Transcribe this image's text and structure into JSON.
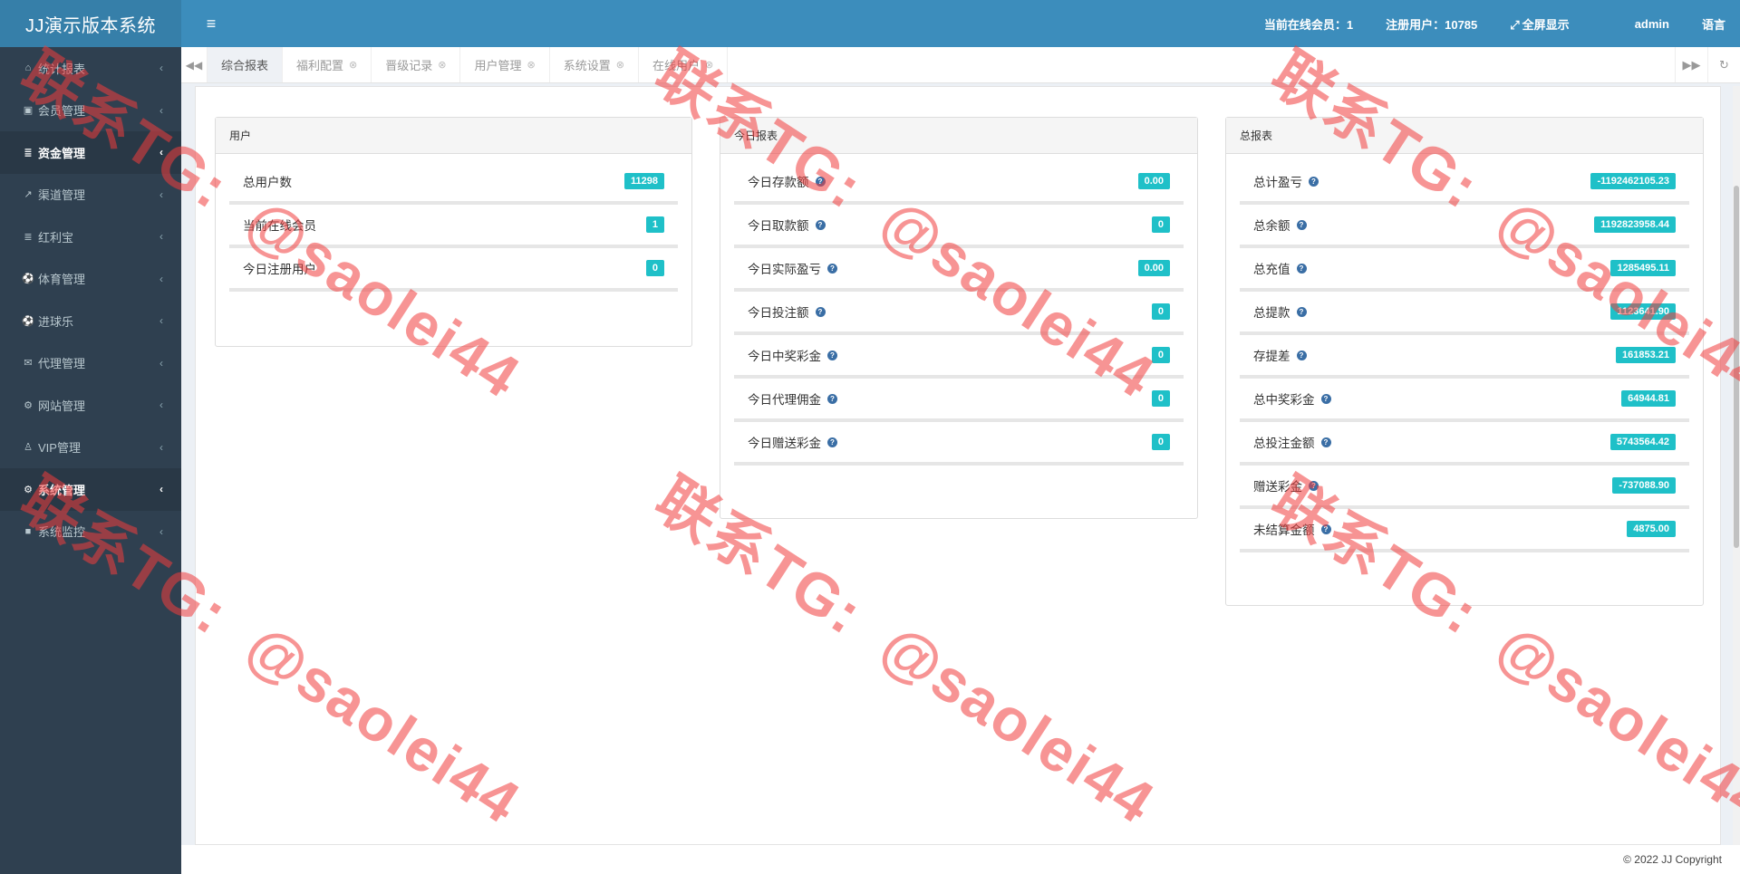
{
  "app": {
    "title": "JJ演示版本系统"
  },
  "sidebar": {
    "items": [
      {
        "label": "统计报表",
        "icon": "home-icon",
        "glyph": "⌂",
        "active": false
      },
      {
        "label": "会员管理",
        "icon": "id-card-icon",
        "glyph": "▣",
        "active": false
      },
      {
        "label": "资金管理",
        "icon": "database-icon",
        "glyph": "≣",
        "active": true
      },
      {
        "label": "渠道管理",
        "icon": "rocket-icon",
        "glyph": "↗",
        "active": false
      },
      {
        "label": "红利宝",
        "icon": "database-icon",
        "glyph": "≣",
        "active": false
      },
      {
        "label": "体育管理",
        "icon": "soccer-ball-icon",
        "glyph": "⚽",
        "active": false
      },
      {
        "label": "进球乐",
        "icon": "soccer-ball-icon",
        "glyph": "⚽",
        "active": false
      },
      {
        "label": "代理管理",
        "icon": "envelope-icon",
        "glyph": "✉",
        "active": false
      },
      {
        "label": "网站管理",
        "icon": "cogs-icon",
        "glyph": "⚙",
        "active": false
      },
      {
        "label": "VIP管理",
        "icon": "user-icon",
        "glyph": "♙",
        "active": false
      },
      {
        "label": "系统管理",
        "icon": "gear-icon",
        "glyph": "⚙",
        "active": true
      },
      {
        "label": "系统监控",
        "icon": "video-camera-icon",
        "glyph": "■",
        "active": false
      }
    ]
  },
  "topbar": {
    "online_members": "当前在线会员：1",
    "registered_users": "注册用户：10785",
    "fullscreen": "全屏显示",
    "user": "admin",
    "language": "语言"
  },
  "tabs": [
    {
      "label": "综合报表",
      "active": true,
      "closable": false
    },
    {
      "label": "福利配置",
      "active": false,
      "closable": true
    },
    {
      "label": "晋级记录",
      "active": false,
      "closable": true
    },
    {
      "label": "用户管理",
      "active": false,
      "closable": true
    },
    {
      "label": "系统设置",
      "active": false,
      "closable": true
    },
    {
      "label": "在线用户",
      "active": false,
      "closable": true
    }
  ],
  "panels": {
    "users": {
      "title": "用户",
      "rows": [
        {
          "label": "总用户数",
          "value": "11298",
          "help": false
        },
        {
          "label": "当前在线会员",
          "value": "1",
          "help": false
        },
        {
          "label": "今日注册用户",
          "value": "0",
          "help": false
        }
      ]
    },
    "today": {
      "title": "今日报表",
      "rows": [
        {
          "label": "今日存款额",
          "value": "0.00",
          "help": true
        },
        {
          "label": "今日取款额",
          "value": "0",
          "help": true
        },
        {
          "label": "今日实际盈亏",
          "value": "0.00",
          "help": true
        },
        {
          "label": "今日投注额",
          "value": "0",
          "help": true
        },
        {
          "label": "今日中奖彩金",
          "value": "0",
          "help": true
        },
        {
          "label": "今日代理佣金",
          "value": "0",
          "help": true
        },
        {
          "label": "今日赠送彩金",
          "value": "0",
          "help": true
        }
      ]
    },
    "total": {
      "title": "总报表",
      "rows": [
        {
          "label": "总计盈亏",
          "value": "-1192462105.23",
          "help": true
        },
        {
          "label": "总余额",
          "value": "1192823958.44",
          "help": true
        },
        {
          "label": "总充值",
          "value": "1285495.11",
          "help": true
        },
        {
          "label": "总提款",
          "value": "1123641.90",
          "help": true
        },
        {
          "label": "存提差",
          "value": "161853.21",
          "help": true
        },
        {
          "label": "总中奖彩金",
          "value": "64944.81",
          "help": true
        },
        {
          "label": "总投注金额",
          "value": "5743564.42",
          "help": true
        },
        {
          "label": "赠送彩金",
          "value": "-737088.90",
          "help": true
        },
        {
          "label": "未结算金额",
          "value": "4875.00",
          "help": true
        }
      ]
    }
  },
  "footer": {
    "copyright": "© 2022 JJ Copyright"
  },
  "watermark": {
    "line1": "联系TG:",
    "line2": "@saolei44"
  },
  "colors": {
    "topbar": "#3c8dbc",
    "sidebar": "#2f4050",
    "badge": "#1fc0c8",
    "watermark": "#f03c3c"
  }
}
